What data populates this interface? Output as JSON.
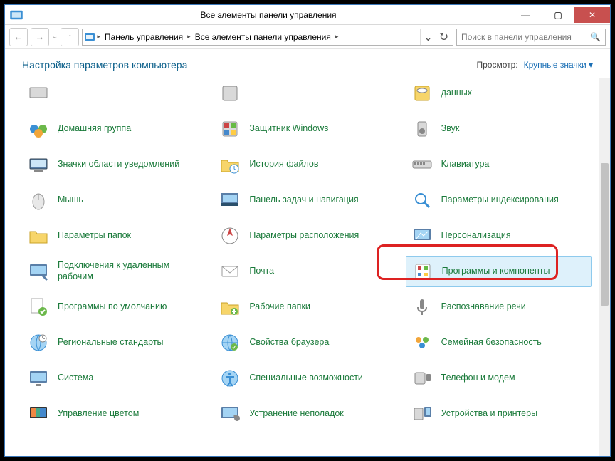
{
  "window": {
    "title": "Все элементы панели управления",
    "min": "—",
    "max": "▢",
    "close": "✕"
  },
  "nav": {
    "back": "←",
    "fwd": "→",
    "up": "↑",
    "refresh": "↻",
    "dropdown": "⌄"
  },
  "breadcrumbs": [
    {
      "label": "Панель управления"
    },
    {
      "label": "Все элементы панели управления"
    }
  ],
  "search": {
    "placeholder": "Поиск в панели управления",
    "icon": "🔍"
  },
  "header": {
    "title": "Настройка параметров компьютера",
    "view_label": "Просмотр:",
    "view_value": "Крупные значки ▾"
  },
  "items": {
    "col1": [
      {
        "label": "",
        "icon": "clip"
      },
      {
        "label": "Домашняя группа",
        "icon": "homegroup"
      },
      {
        "label": "Значки области уведомлений",
        "icon": "tray"
      },
      {
        "label": "Мышь",
        "icon": "mouse"
      },
      {
        "label": "Параметры папок",
        "icon": "folderopt"
      },
      {
        "label": "Подключения к удаленным рабочим",
        "icon": "remote"
      },
      {
        "label": "Программы по умолчанию",
        "icon": "defaults"
      },
      {
        "label": "Региональные стандарты",
        "icon": "region"
      },
      {
        "label": "Система",
        "icon": "system"
      },
      {
        "label": "Управление цветом",
        "icon": "color"
      }
    ],
    "col2": [
      {
        "label": "",
        "icon": "device"
      },
      {
        "label": "Защитник Windows",
        "icon": "defender"
      },
      {
        "label": "История файлов",
        "icon": "filehist"
      },
      {
        "label": "Панель задач и навигация",
        "icon": "taskbar"
      },
      {
        "label": "Параметры расположения",
        "icon": "location"
      },
      {
        "label": "Почта",
        "icon": "mail"
      },
      {
        "label": "Рабочие папки",
        "icon": "workfolders"
      },
      {
        "label": "Свойства браузера",
        "icon": "inetopt"
      },
      {
        "label": "Специальные возможности",
        "icon": "ease"
      },
      {
        "label": "Устранение неполадок",
        "icon": "trouble"
      }
    ],
    "col3": [
      {
        "label": "данных",
        "icon": "datasrc"
      },
      {
        "label": "Звук",
        "icon": "sound"
      },
      {
        "label": "Клавиатура",
        "icon": "keyboard"
      },
      {
        "label": "Параметры индексирования",
        "icon": "index"
      },
      {
        "label": "Персонализация",
        "icon": "personalize"
      },
      {
        "label": "Программы и компоненты",
        "icon": "programs",
        "highlight": true
      },
      {
        "label": "Распознавание речи",
        "icon": "speech"
      },
      {
        "label": "Семейная безопасность",
        "icon": "family"
      },
      {
        "label": "Телефон и модем",
        "icon": "phone"
      },
      {
        "label": "Устройства и принтеры",
        "icon": "devices"
      }
    ]
  }
}
